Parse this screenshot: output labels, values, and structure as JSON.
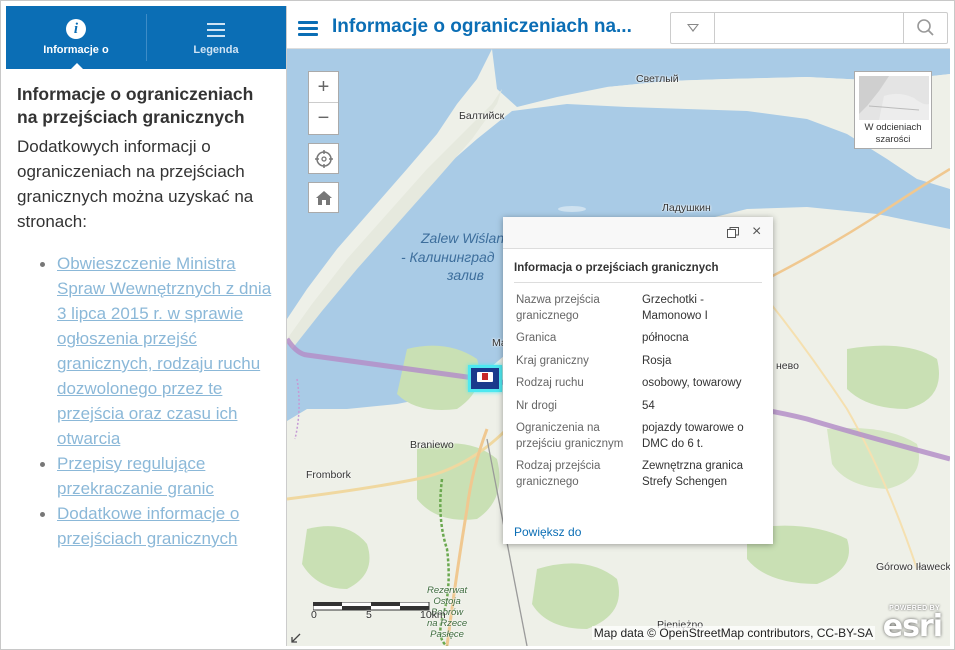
{
  "sidebar": {
    "tabs": [
      {
        "label": "Informacje o",
        "icon": "info-icon"
      },
      {
        "label": "Legenda",
        "icon": "list-icon"
      }
    ],
    "title": "Informacje o ograniczeniach na przejściach granicznych",
    "intro": "Dodatkowych informacji o ograniczeniach na przejściach granicznych można uzyskać na stronach:",
    "links": [
      "Obwieszczenie Ministra Spraw Wewnętrznych z dnia 3 lipca 2015 r. w sprawie ogłoszenia przejść granicznych, rodzaju ruchu dozwolonego przez te przejścia oraz czasu ich otwarcia",
      "Przepisy regulujące przekraczanie granic",
      "Dodatkowe informacje o przejściach granicznych"
    ]
  },
  "header": {
    "title": "Informacje o ograniczeniach na...",
    "search_placeholder": ""
  },
  "map": {
    "labels": {
      "svetly": "Светлый",
      "baltiysk": "Балтийск",
      "ladushkin": "Ладушкин",
      "zalew1": "Zalew Wiślan",
      "zalew2": "- Калининград",
      "zalew3": "залив",
      "braniewo": "Braniewo",
      "frombork": "Frombork",
      "mamonovo": "Ма",
      "evo": "нево",
      "gorowo": "Górowo Iławeckie",
      "pieniezno": "Pieniężno",
      "rezerwat": "Rezerwat\nOstoja\nBobrów\nna Rzece\nPasłęce"
    },
    "basemap_label": "W odcieniach szarości",
    "scale": {
      "labels": [
        "0",
        "5",
        "10km"
      ]
    },
    "attribution": "Map data © OpenStreetMap contributors, CC-BY-SA",
    "esri": {
      "powered": "POWERED BY",
      "logo": "esri"
    }
  },
  "popup": {
    "title": "Informacja o przejściach granicznych",
    "rows": [
      {
        "key": "Nazwa przejścia granicznego",
        "value": "Grzechotki - Mamonowo I"
      },
      {
        "key": "Granica",
        "value": "północna"
      },
      {
        "key": "Kraj graniczny",
        "value": "Rosja"
      },
      {
        "key": "Rodzaj ruchu",
        "value": "osobowy, towarowy"
      },
      {
        "key": "Nr drogi",
        "value": "54"
      },
      {
        "key": "Ograniczenia na przejściu granicznym",
        "value": "pojazdy towarowe o DMC do 6 t."
      },
      {
        "key": "Rodzaj przejścia granicznego",
        "value": "Zewnętrzna granica Strefy Schengen"
      }
    ],
    "zoom_link": "Powiększ do"
  },
  "colors": {
    "accent": "#0b6eb5",
    "water": "#a9cbe6",
    "land": "#eef0e8",
    "forest": "#c9e0b4",
    "border_line": "#b48fc8",
    "marker_highlight": "#4ee8f0"
  }
}
